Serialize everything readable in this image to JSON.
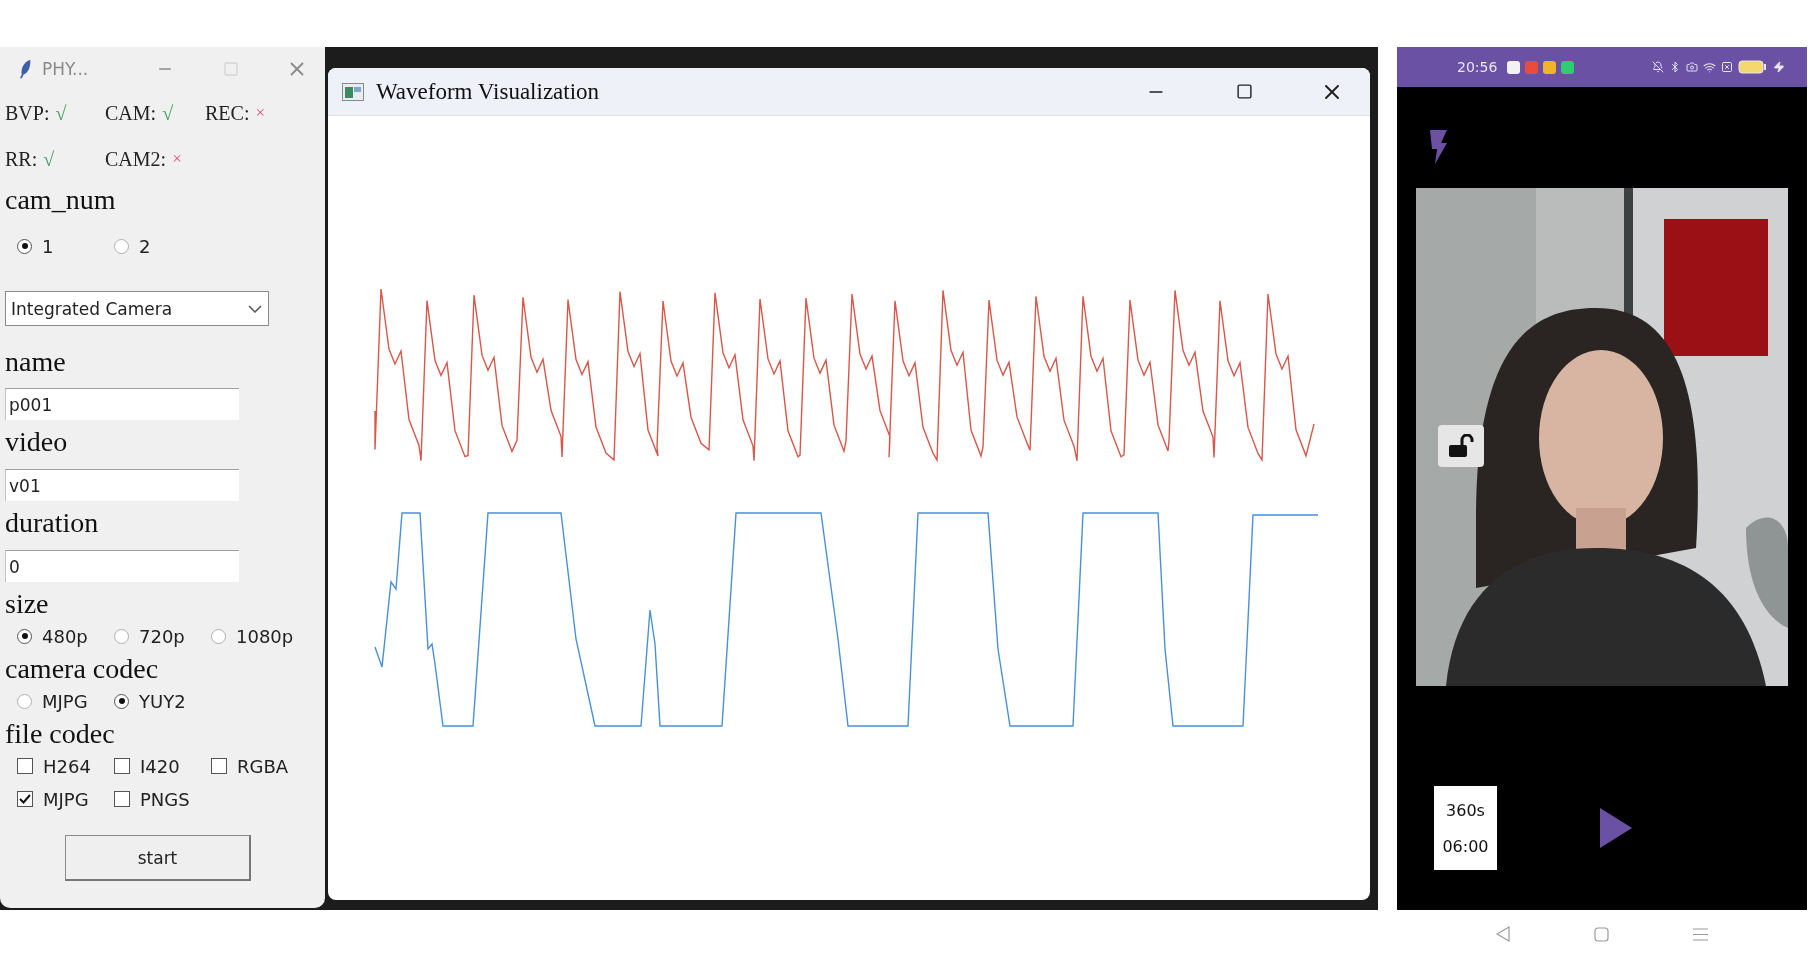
{
  "left_window": {
    "title": "PHY...",
    "status_rows": [
      [
        {
          "label": "BVP:",
          "mark": "√",
          "ok": true
        },
        {
          "label": "CAM:",
          "mark": "√",
          "ok": true
        },
        {
          "label": "REC:",
          "mark": "×",
          "ok": false
        }
      ],
      [
        {
          "label": "RR:",
          "mark": "√",
          "ok": true
        },
        {
          "label": "CAM2:",
          "mark": "×",
          "ok": false
        }
      ]
    ],
    "cam_num": {
      "label": "cam_num",
      "options": [
        {
          "label": "1",
          "selected": true
        },
        {
          "label": "2",
          "selected": false
        }
      ]
    },
    "camera_select": {
      "value": "Integrated Camera"
    },
    "fields": [
      {
        "label": "name",
        "value": "p001"
      },
      {
        "label": "video",
        "value": "v01"
      },
      {
        "label": "duration",
        "value": "0"
      }
    ],
    "size": {
      "label": "size",
      "options": [
        {
          "label": "480p",
          "selected": true
        },
        {
          "label": "720p",
          "selected": false
        },
        {
          "label": "1080p",
          "selected": false
        }
      ]
    },
    "camera_codec": {
      "label": "camera codec",
      "options": [
        {
          "label": "MJPG",
          "selected": false
        },
        {
          "label": "YUY2",
          "selected": true
        }
      ]
    },
    "file_codec": {
      "label": "file codec",
      "options": [
        {
          "label": "H264",
          "checked": false
        },
        {
          "label": "I420",
          "checked": false
        },
        {
          "label": "RGBA",
          "checked": false
        },
        {
          "label": "MJPG",
          "checked": true
        },
        {
          "label": "PNGS",
          "checked": false
        }
      ]
    },
    "start_button": "start"
  },
  "waveform_window": {
    "title": "Waveform Visualization"
  },
  "phone": {
    "status_bar": {
      "time": "20:56"
    },
    "timer": {
      "seconds": "360s",
      "clock": "06:00"
    }
  }
}
